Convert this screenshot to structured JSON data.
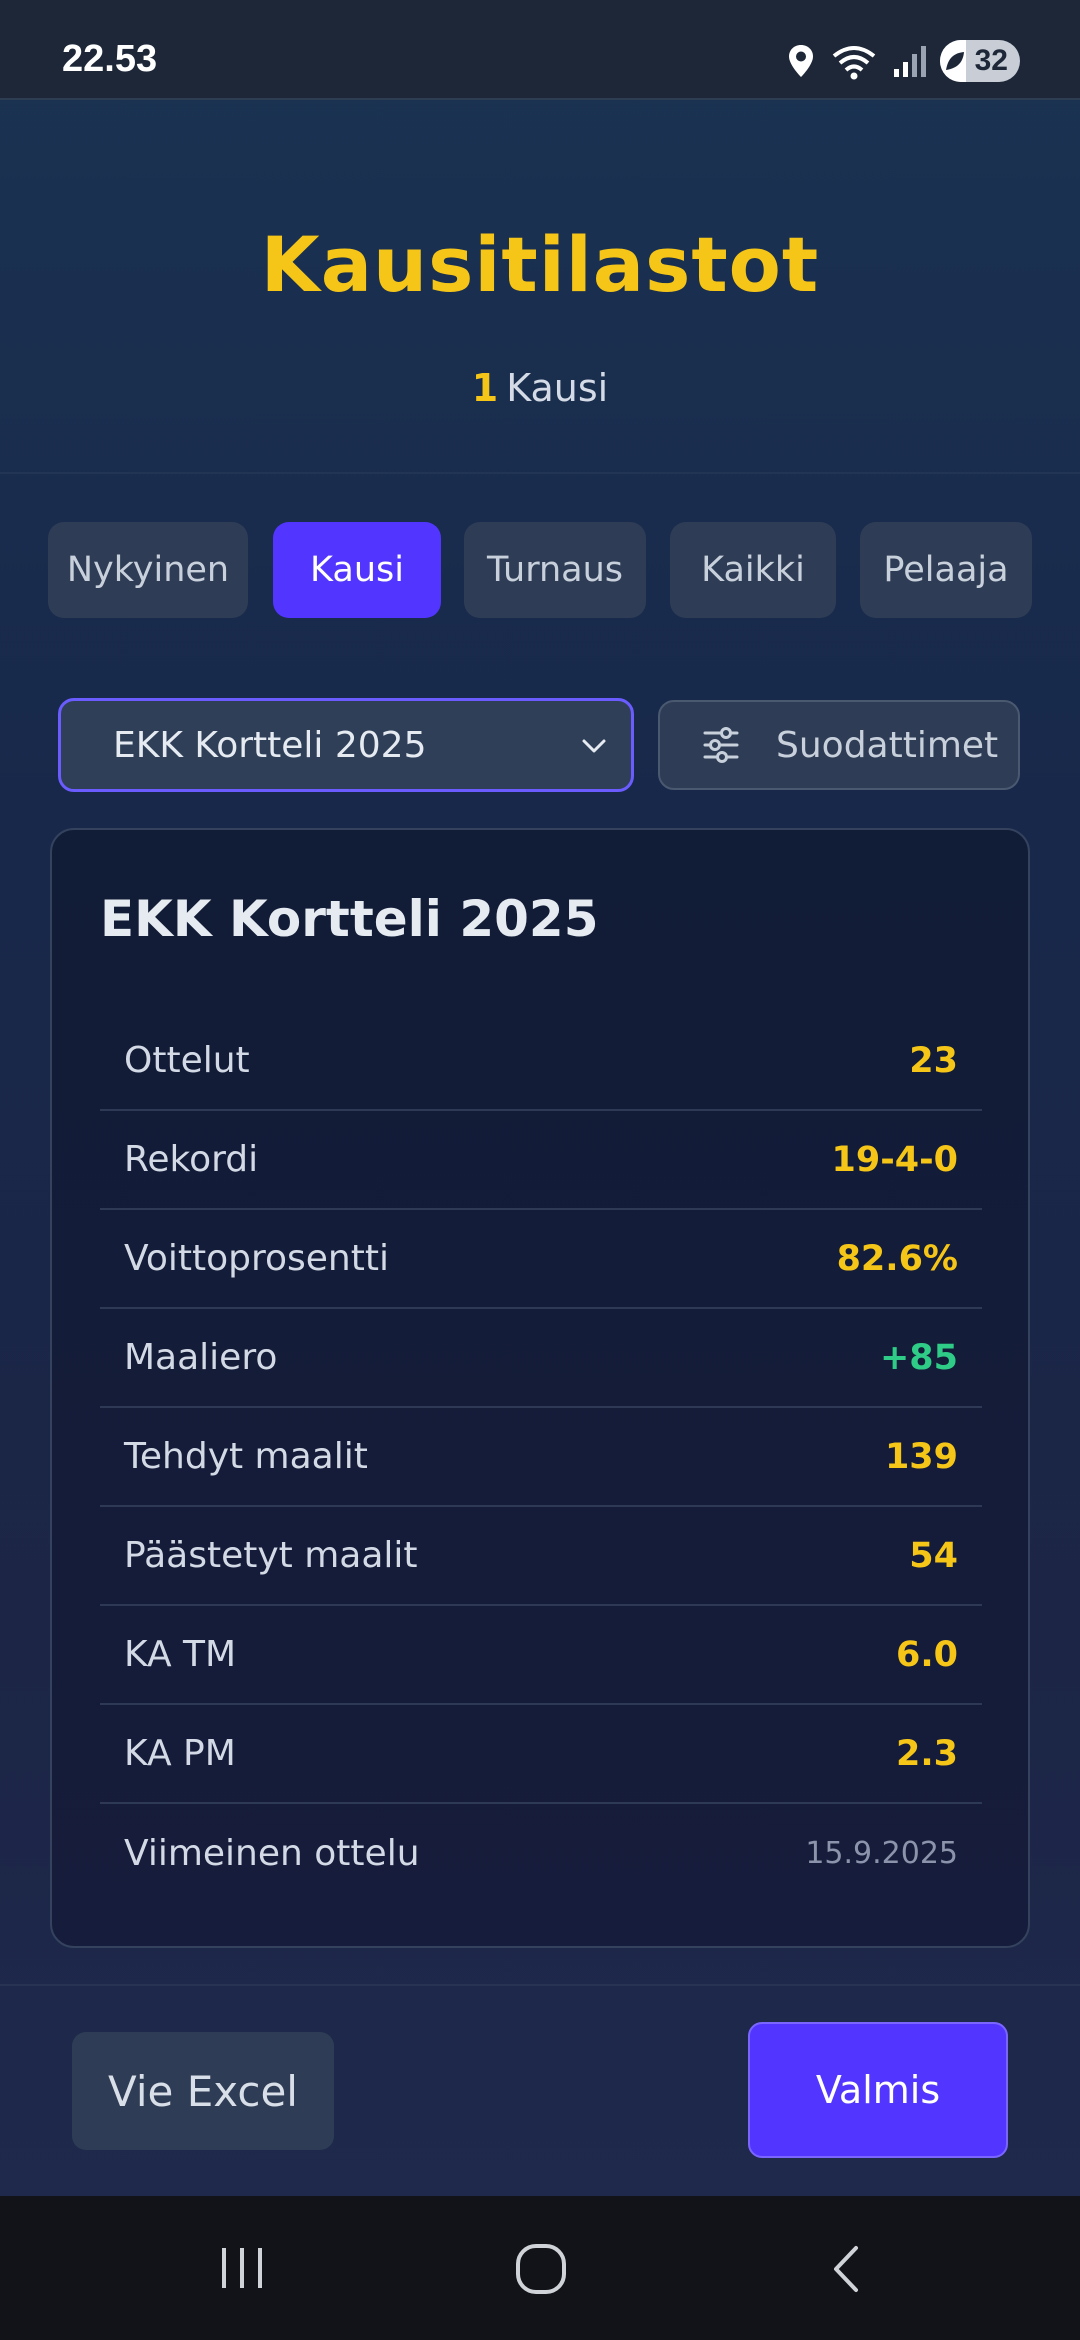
{
  "status_bar": {
    "time": "22.53",
    "battery": "32",
    "icons": [
      "location-icon",
      "wifi-icon",
      "signal-icon",
      "battery-icon"
    ]
  },
  "header": {
    "title": "Kausitilastot",
    "subtitle_count": "1",
    "subtitle_label": "Kausi"
  },
  "tabs": [
    {
      "label": "Nykyinen",
      "active": false
    },
    {
      "label": "Kausi",
      "active": true
    },
    {
      "label": "Turnaus",
      "active": false
    },
    {
      "label": "Kaikki",
      "active": false
    },
    {
      "label": "Pelaaja",
      "active": false
    }
  ],
  "season_select": {
    "value": "EKK Kortteli 2025"
  },
  "filters_button": {
    "label": "Suodattimet"
  },
  "card": {
    "title": "EKK Kortteli 2025",
    "rows": [
      {
        "label": "Ottelut",
        "value": "23"
      },
      {
        "label": "Rekordi",
        "value": "19-4-0"
      },
      {
        "label": "Voittoprosentti",
        "value": "82.6%"
      },
      {
        "label": "Maaliero",
        "value": "+85"
      },
      {
        "label": "Tehdyt maalit",
        "value": "139"
      },
      {
        "label": "Päästetyt maalit",
        "value": "54"
      },
      {
        "label": "KA TM",
        "value": "6.0"
      },
      {
        "label": "KA PM",
        "value": "2.3"
      },
      {
        "label": "Viimeinen ottelu",
        "value": "15.9.2025"
      }
    ]
  },
  "footer": {
    "export_label": "Vie Excel",
    "done_label": "Valmis"
  },
  "colors": {
    "accent": "#5236ff",
    "highlight": "#f5c518",
    "positive": "#2ecc87"
  }
}
